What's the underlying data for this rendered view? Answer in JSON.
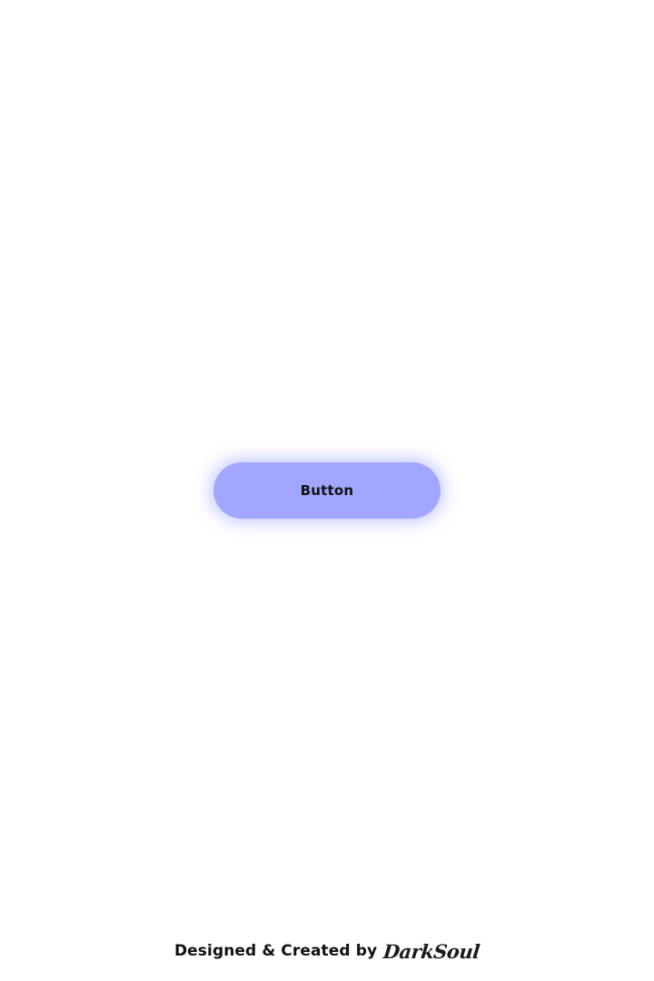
{
  "main": {
    "button_label": "Button"
  },
  "footer": {
    "text": "Designed & Created by",
    "author": "DarkSoul"
  },
  "colors": {
    "button_background": "#a2a6ff",
    "page_background": "#ffffff",
    "text": "#111111"
  }
}
